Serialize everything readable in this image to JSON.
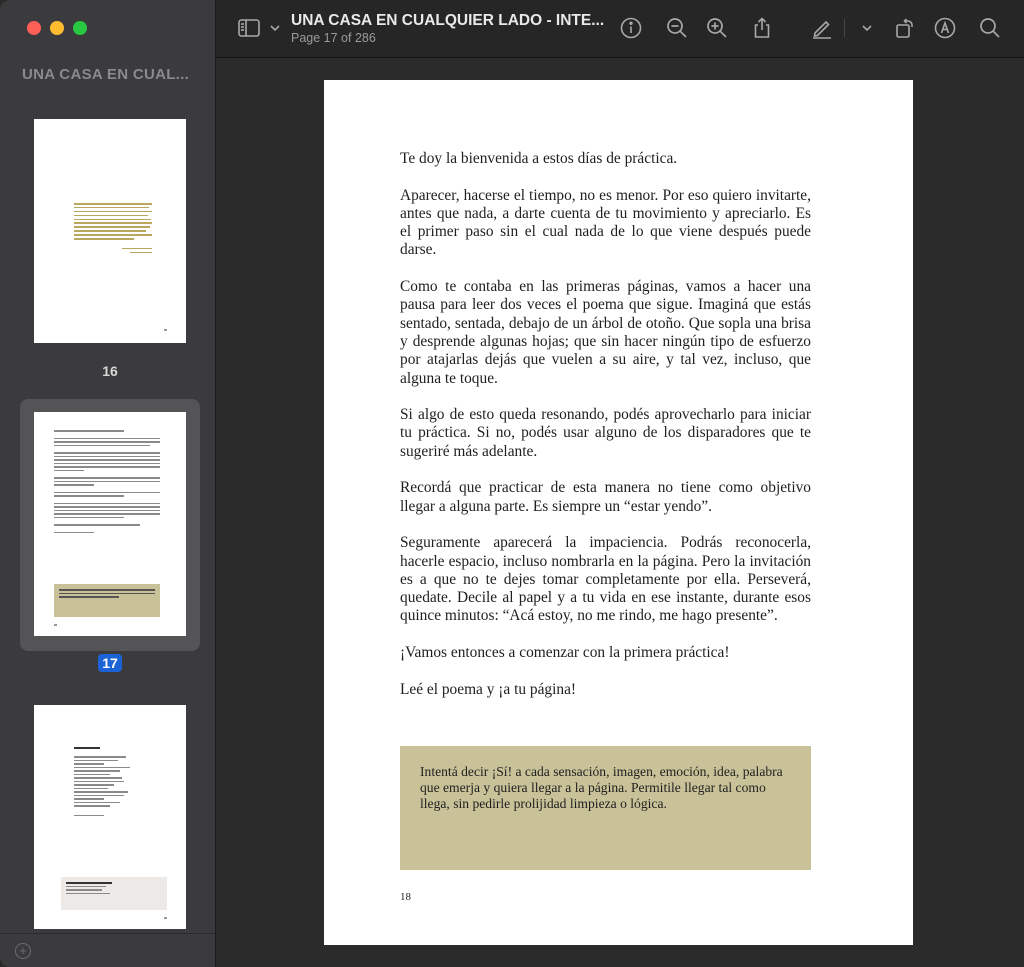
{
  "window": {
    "sidebar_title": "UNA CASA EN CUAL...",
    "doc_title": "UNA CASA EN CUALQUIER LADO - INTE...",
    "page_indicator": "Page 17 of 286"
  },
  "toolbar": {
    "icons": [
      "sidebar-toggle-icon",
      "chevron-down-icon",
      "info-icon",
      "zoom-out-icon",
      "zoom-in-icon",
      "share-icon",
      "markup-pen-icon",
      "chevron-down-icon",
      "rotate-icon",
      "annotate-icon",
      "search-icon"
    ]
  },
  "thumbnails": [
    {
      "label": "16",
      "selected": false
    },
    {
      "label": "17",
      "selected": true
    },
    {
      "label": "",
      "selected": false
    }
  ],
  "page": {
    "paragraphs": [
      "Te doy la bienvenida a estos días de práctica.",
      "Aparecer, hacerse el tiempo, no es menor. Por eso quiero invitarte, antes que nada, a darte cuenta de tu movimiento y apreciarlo. Es el primer paso sin el cual nada de lo que viene después puede darse.",
      "Como te contaba en las primeras páginas, vamos a hacer una pausa para leer dos veces el poema que sigue. Imaginá que estás sentado, sentada, debajo de un árbol de otoño. Que sopla una brisa y desprende algunas hojas; que sin hacer ningún tipo de esfuerzo por atajarlas dejás que vuelen a su aire, y tal vez, incluso, que alguna te toque.",
      "Si algo de esto queda resonando, podés aprovecharlo para iniciar tu práctica. Si no, podés usar alguno de los disparadores que te sugeriré más adelante.",
      "Recordá que practicar de esta manera no tiene como objetivo llegar a alguna parte. Es siempre un “estar yendo”.",
      "Seguramente aparecerá la impaciencia. Podrás reconocerla, hacerle espacio, incluso nombrarla en la página. Pero la invitación es a que no te dejes tomar completamente por ella. Perseverá, quedate. Decile al papel y a tu vida en ese instante, durante esos quince minutos: “Acá estoy, no me rindo, me hago presente”.",
      "¡Vamos entonces a comenzar con la primera práctica!",
      "Leé el poema y ¡a tu página!"
    ],
    "callout": "Intentá decir ¡Sí! a cada sensación, imagen, emoción, idea, palabra que emerja y quiera llegar a la página. Permitile llegar tal como llega, sin pedirle prolijidad limpieza o lógica.",
    "page_number": "18"
  },
  "colors": {
    "callout_bg": "#c9c299",
    "selection_blue": "#1b63d6",
    "sidebar_bg": "#3b3b3d"
  }
}
